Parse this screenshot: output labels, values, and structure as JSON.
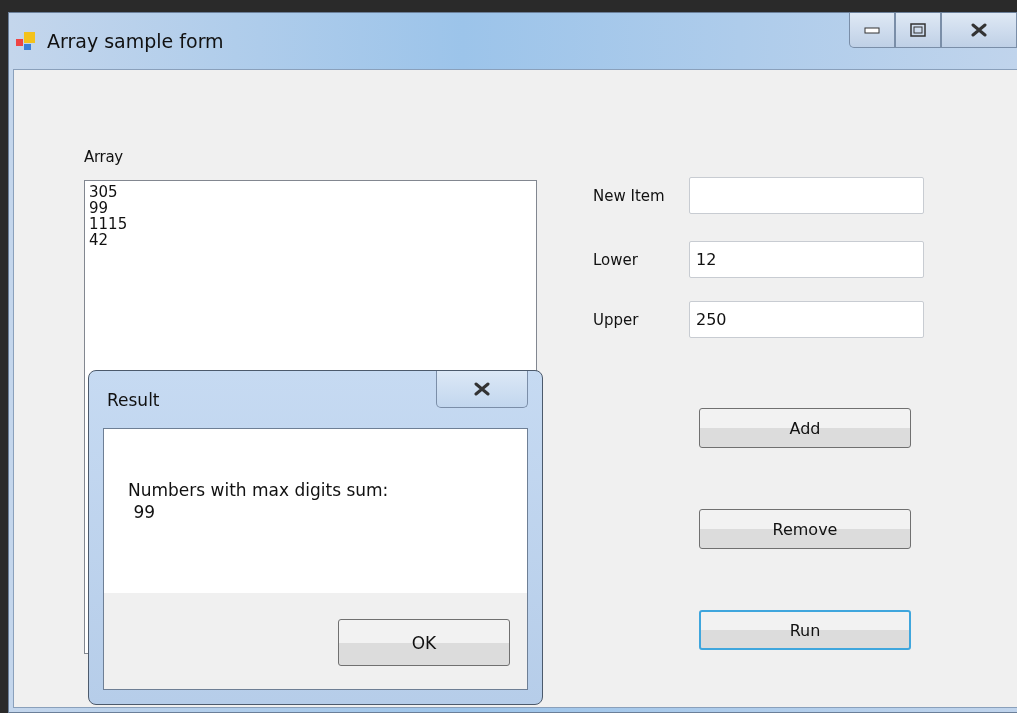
{
  "window": {
    "title": "Array sample form"
  },
  "list": {
    "label": "Array",
    "items": [
      "305",
      "99",
      "1115",
      "42"
    ]
  },
  "fields": [
    {
      "label": "New Item"
    },
    {
      "label": "Lower",
      "value": "12"
    },
    {
      "label": "Upper",
      "value": "250"
    }
  ],
  "buttons": [
    {
      "label": "Add",
      "focused": false
    },
    {
      "label": "Remove",
      "focused": false
    },
    {
      "label": "Run",
      "focused": true
    }
  ],
  "dialog": {
    "title": "Result",
    "message": [
      "Numbers with max digits sum:",
      " 99"
    ],
    "button": "OK"
  }
}
